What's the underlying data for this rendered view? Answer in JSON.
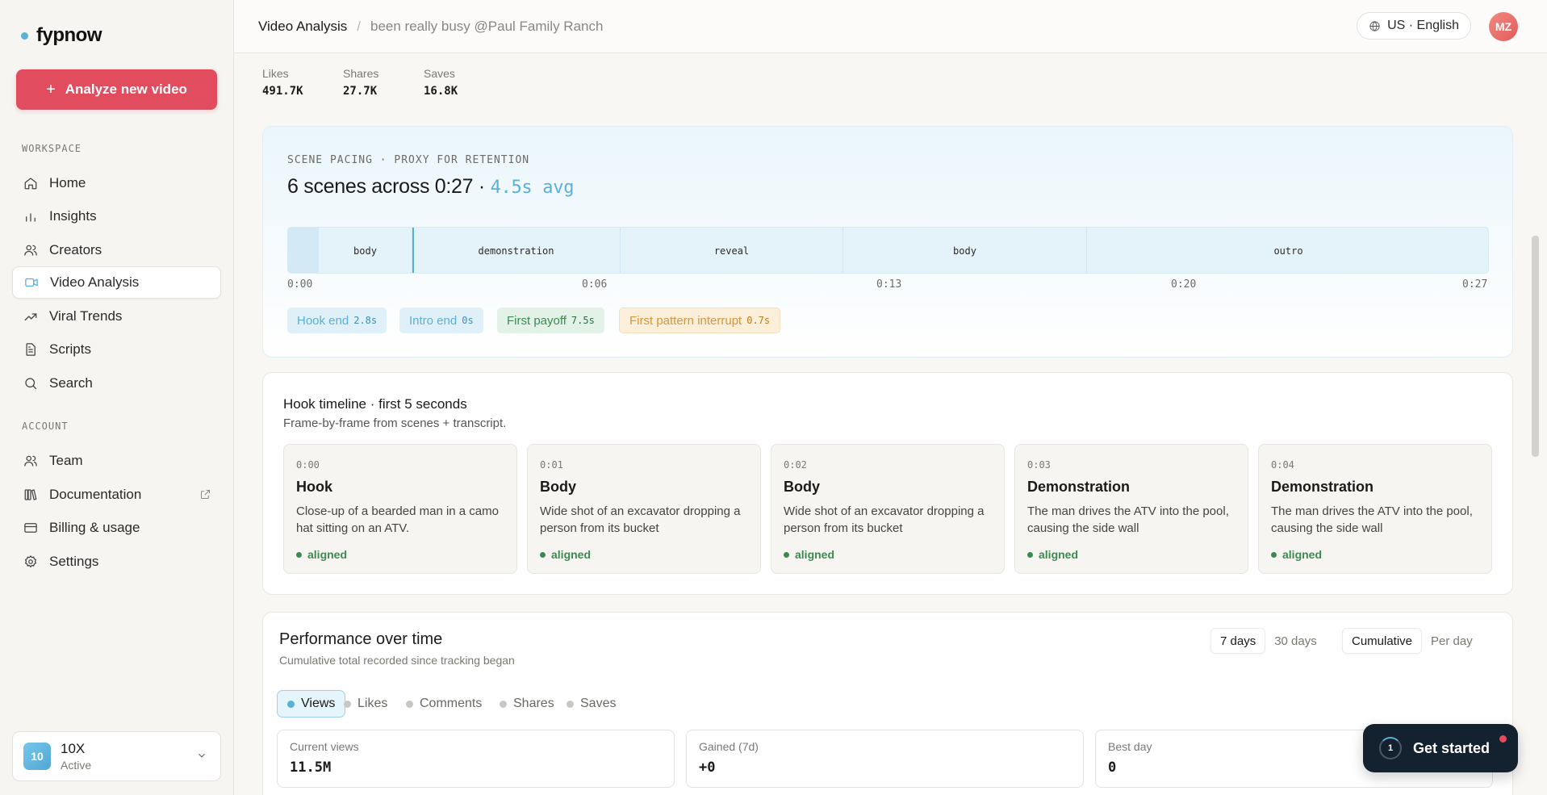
{
  "app": {
    "name": "fypnow"
  },
  "sidebar": {
    "analyze_label": "Analyze new video",
    "workspace_label": "WORKSPACE",
    "account_label": "ACCOUNT",
    "workspace_items": [
      {
        "label": "Home",
        "icon": "home-icon"
      },
      {
        "label": "Insights",
        "icon": "bar-chart-icon"
      },
      {
        "label": "Creators",
        "icon": "users-icon"
      },
      {
        "label": "Video Analysis",
        "icon": "video-icon",
        "active": true
      },
      {
        "label": "Viral Trends",
        "icon": "trend-icon"
      },
      {
        "label": "Scripts",
        "icon": "document-icon"
      },
      {
        "label": "Search",
        "icon": "search-icon"
      }
    ],
    "account_items": [
      {
        "label": "Team",
        "icon": "users-icon"
      },
      {
        "label": "Documentation",
        "icon": "book-icon"
      },
      {
        "label": "Billing & usage",
        "icon": "card-icon"
      },
      {
        "label": "Settings",
        "icon": "gear-icon"
      }
    ],
    "plan": {
      "badge": "10",
      "name": "10X",
      "status": "Active"
    }
  },
  "header": {
    "crumb_main": "Video Analysis",
    "crumb_sep": "/",
    "crumb_sub": "been really busy @Paul Family Ranch",
    "language": "US · English",
    "avatar_initials": "MZ"
  },
  "stats": [
    {
      "label": "Likes",
      "value": "491.7K"
    },
    {
      "label": "Shares",
      "value": "27.7K"
    },
    {
      "label": "Saves",
      "value": "16.8K"
    }
  ],
  "pacing": {
    "label": "SCENE PACING · PROXY FOR RETENTION",
    "title": "6 scenes across 0:27 ·",
    "avg": "4.5s avg",
    "segments": [
      "body",
      "demonstration",
      "reveal",
      "body",
      "outro"
    ],
    "ticks": [
      "0:00",
      "0:06",
      "0:13",
      "0:20",
      "0:27"
    ],
    "pills": [
      {
        "label": "Hook end",
        "value": "2.8s"
      },
      {
        "label": "Intro end",
        "value": "0s"
      },
      {
        "label": "First payoff",
        "value": "7.5s"
      },
      {
        "label": "First pattern interrupt",
        "value": "0.7s"
      }
    ]
  },
  "hook": {
    "title": "Hook timeline · first 5 seconds",
    "subtitle": "Frame-by-frame from scenes + transcript.",
    "frames": [
      {
        "time": "0:00",
        "heading": "Hook",
        "desc": "Close-up of a bearded man in a camo hat sitting on an ATV.",
        "status": "aligned"
      },
      {
        "time": "0:01",
        "heading": "Body",
        "desc": "Wide shot of an excavator dropping a person from its bucket",
        "status": "aligned"
      },
      {
        "time": "0:02",
        "heading": "Body",
        "desc": "Wide shot of an excavator dropping a person from its bucket",
        "status": "aligned"
      },
      {
        "time": "0:03",
        "heading": "Demonstration",
        "desc": "The man drives the ATV into the pool, causing the side wall",
        "status": "aligned"
      },
      {
        "time": "0:04",
        "heading": "Demonstration",
        "desc": "The man drives the ATV into the pool, causing the side wall",
        "status": "aligned"
      }
    ]
  },
  "performance": {
    "title": "Performance over time",
    "subtitle": "Cumulative total recorded since tracking began",
    "range_options": [
      "7 days",
      "30 days"
    ],
    "mode_options": [
      "Cumulative",
      "Per day"
    ],
    "metrics": [
      "Views",
      "Likes",
      "Comments",
      "Shares",
      "Saves"
    ],
    "kpis": [
      {
        "label": "Current views",
        "value": "11.5M"
      },
      {
        "label": "Gained (7d)",
        "value": "+0"
      },
      {
        "label": "Best day",
        "value": "0"
      }
    ]
  },
  "get_started": {
    "label": "Get started",
    "step": "1"
  },
  "colors": {
    "accent": "#5ab0d6",
    "brand_red": "#e14d5f",
    "success": "#3c8a51"
  }
}
